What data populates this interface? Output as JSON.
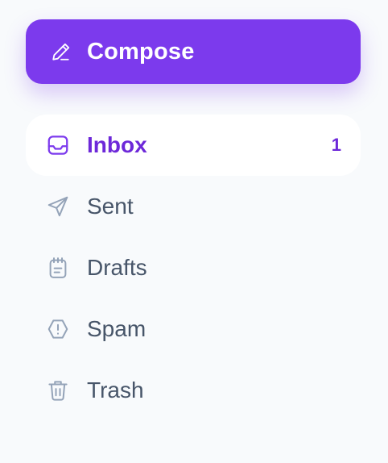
{
  "compose": {
    "label": "Compose",
    "icon": "pencil-icon",
    "color": "#7c3aed"
  },
  "nav": {
    "items": [
      {
        "label": "Inbox",
        "icon": "inbox-icon",
        "badge": "1",
        "active": true
      },
      {
        "label": "Sent",
        "icon": "send-icon",
        "active": false
      },
      {
        "label": "Drafts",
        "icon": "drafts-icon",
        "active": false
      },
      {
        "label": "Spam",
        "icon": "alert-octagon-icon",
        "active": false
      },
      {
        "label": "Trash",
        "icon": "trash-icon",
        "active": false
      }
    ]
  },
  "colors": {
    "accent": "#7c3aed",
    "active_text": "#6d28d9",
    "inactive_text": "#475569",
    "inactive_icon": "#94a3b8",
    "background": "#f8fafc"
  }
}
